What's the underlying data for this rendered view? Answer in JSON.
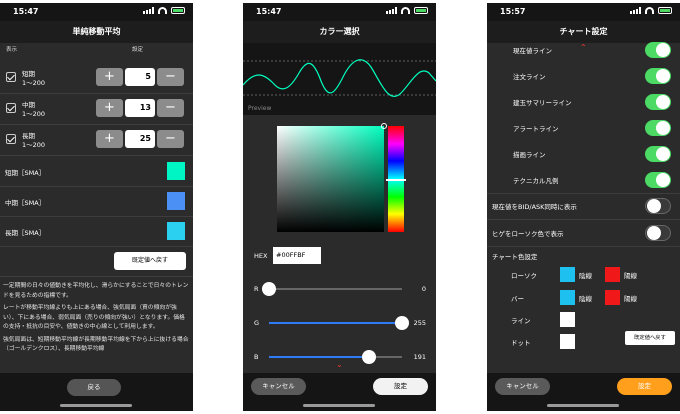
{
  "status_bar": {
    "time_a": "15:47",
    "time_b": "15:47",
    "time_c": "15:57"
  },
  "sma_screen": {
    "title": "単純移動平均",
    "col_display": "表示",
    "col_setting": "設定",
    "periods": [
      {
        "name": "短期",
        "range": "1〜200",
        "value": "5"
      },
      {
        "name": "中期",
        "range": "1〜200",
        "value": "13"
      },
      {
        "name": "長期",
        "range": "1〜200",
        "value": "25"
      }
    ],
    "plus": "+",
    "minus": "−",
    "swatches": [
      {
        "label": "短期［SMA］",
        "color": "#00f5c4"
      },
      {
        "label": "中期［SMA］",
        "color": "#4b90f5"
      },
      {
        "label": "長期［SMA］",
        "color": "#2bd0f0"
      }
    ],
    "reset_label": "既定値へ戻す",
    "desc_1": "一定期間の日々の値動きを平均化し、滑らかにすることで日々のトレンドを見るための指標です。",
    "desc_2": "レートが移動平均線よりも上にある場合、強気局面（買の傾向が強い）、下にある場合、弱気局面（売りの傾向が強い）となります。価格の支持・抵抗の目安や、値動きの中心線として利用します。",
    "desc_3": "強気局面は、短期移動平均線が長期移動平均線を下から上に抜ける場合（ゴールデンクロス）、長期移動平均線",
    "back_label": "戻る"
  },
  "color_screen": {
    "title": "カラー選択",
    "preview_label": "Preview",
    "hex_label": "HEX",
    "hex_value": "#00FFBF",
    "sliders": [
      {
        "label": "R",
        "value": "0",
        "fraction": 0.0
      },
      {
        "label": "G",
        "value": "255",
        "fraction": 1.0
      },
      {
        "label": "B",
        "value": "191",
        "fraction": 0.75
      }
    ],
    "cancel_label": "キャンセル",
    "set_label": "設定",
    "selected_color": "#00ffbf",
    "hue_scroll": "⌄"
  },
  "chart_settings": {
    "title": "チャート設定",
    "toggles": [
      {
        "label": "現在値ライン",
        "on": true
      },
      {
        "label": "注文ライン",
        "on": true
      },
      {
        "label": "建玉サマリーライン",
        "on": true
      },
      {
        "label": "アラートライン",
        "on": true
      },
      {
        "label": "描画ライン",
        "on": true
      },
      {
        "label": "テクニカル凡例",
        "on": true
      },
      {
        "label": "現在値をBID/ASK同時に表示",
        "on": false
      },
      {
        "label": "ヒゲをローソク色で表示",
        "on": false
      }
    ],
    "color_section": "チャート色設定",
    "color_rows": [
      {
        "label": "ローソク",
        "up_label": "陰線",
        "up_color": "#1ec0f0",
        "down_label": "陽線",
        "down_color": "#f01818"
      },
      {
        "label": "バー",
        "up_label": "陰線",
        "up_color": "#1ec0f0",
        "down_label": "陽線",
        "down_color": "#f01818"
      },
      {
        "label": "ライン",
        "color": "#ffffff"
      },
      {
        "label": "ドット",
        "color": "#ffffff"
      }
    ],
    "reset_label": "既定値へ戻す",
    "cancel_label": "キャンセル",
    "set_label": "設定",
    "toggle_on_color": "#4cd964",
    "accent_button_color": "#ff9f1c"
  }
}
